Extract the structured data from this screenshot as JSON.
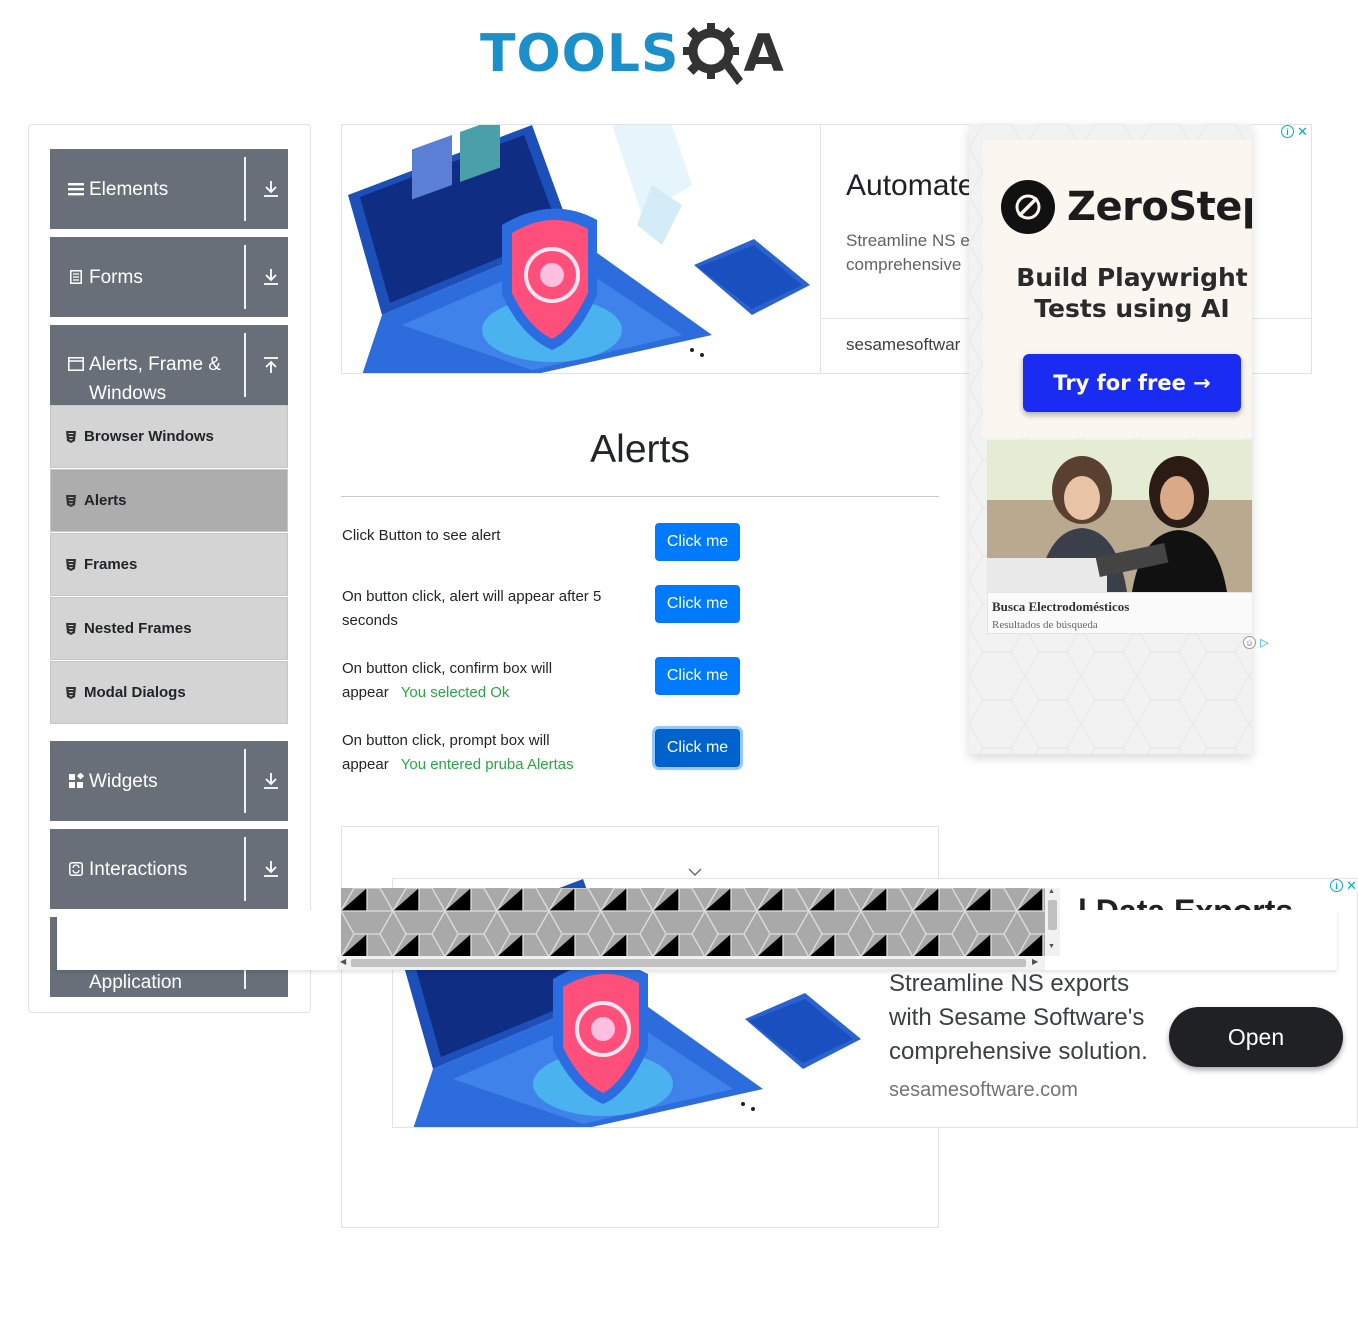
{
  "header": {
    "logo_text_left": "TOOLS",
    "logo_text_right": "A",
    "logo_alt": "TOOLSQA"
  },
  "sidebar": {
    "groups": [
      {
        "label": "Elements",
        "icon": "hamburger-icon",
        "arrow": "download-arrow-icon"
      },
      {
        "label": "Forms",
        "icon": "form-doc-icon",
        "arrow": "download-arrow-icon"
      },
      {
        "label": "Alerts, Frame &",
        "label2": "Windows",
        "icon": "window-icon",
        "arrow": "upload-arrow-icon"
      },
      {
        "label": "Widgets",
        "icon": "widgets-icon",
        "arrow": "download-arrow-icon"
      },
      {
        "label": "Interactions",
        "icon": "interactions-icon",
        "arrow": "download-arrow-icon"
      },
      {
        "label": "Application",
        "icon": "",
        "arrow": ""
      }
    ],
    "submenu": [
      {
        "label": "Browser Windows",
        "active": false
      },
      {
        "label": "Alerts",
        "active": true
      },
      {
        "label": "Frames",
        "active": false
      },
      {
        "label": "Nested Frames",
        "active": false
      },
      {
        "label": "Modal Dialogs",
        "active": false
      }
    ]
  },
  "top_ad": {
    "title": "Automate",
    "desc_line1": "Streamline NS e",
    "desc_line2": "comprehensive",
    "domain": "sesamesoftwar"
  },
  "side_ad": {
    "brand": "ZeroStep",
    "tagline1": "Build Playwright",
    "tagline2": "Tests using AI",
    "cta": "Try for free →",
    "photo_title": "Busca Electrodomésticos",
    "photo_subtitle": "Resultados de búsqueda",
    "colors": {
      "cta": "#1a2cf2",
      "card": "#fbf6ef"
    }
  },
  "main": {
    "title": "Alerts",
    "rows": [
      {
        "label": "Click Button to see alert",
        "label2": "",
        "result": "",
        "button": "Click me"
      },
      {
        "label": "On button click, alert will appear after 5",
        "label2": "seconds",
        "result": "",
        "button": "Click me"
      },
      {
        "label": "On button click, confirm box will",
        "label2": "appear",
        "result": "You selected Ok",
        "button": "Click me"
      },
      {
        "label": "On button click, prompt box will",
        "label2": "appear",
        "result": "You entered pruba Alertas",
        "button": "Click me"
      }
    ],
    "colors": {
      "button": "#007bff",
      "success": "#28a745"
    }
  },
  "bottom_ad": {
    "title_fragment": "l Data Exports",
    "desc": "Streamline NS exports with Sesame Software's comprehensive solution.",
    "domain": "sesamesoftware.com",
    "open": "Open"
  }
}
